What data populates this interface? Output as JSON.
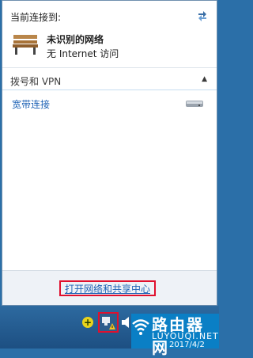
{
  "flyout": {
    "header": "当前连接到:",
    "network": {
      "name": "未识别的网络",
      "status": "无 Internet 访问"
    },
    "section": {
      "title": "拨号和 VPN"
    },
    "connections": [
      {
        "name": "宽带连接"
      }
    ],
    "footer_link": "打开网络和共享中心"
  },
  "taskbar": {
    "tray_icons": [
      "action-center-plus",
      "network",
      "speaker"
    ],
    "date": "2017/4/2"
  },
  "watermark": {
    "title": "路由器网",
    "url": "LUYOUQI.NET"
  },
  "colors": {
    "link": "#1e62b5",
    "highlight": "#e0102e",
    "taskbar": "#1d4f82"
  }
}
